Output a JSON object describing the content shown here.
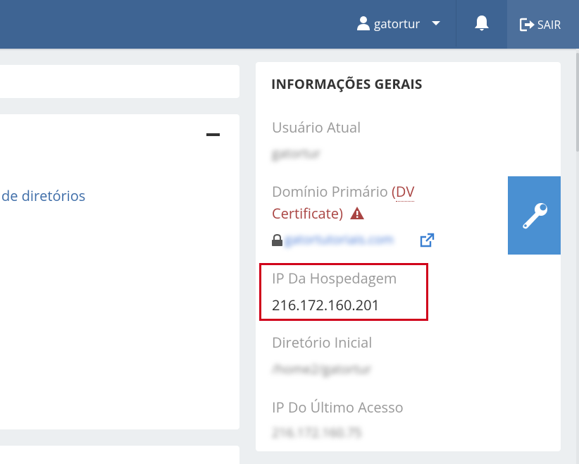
{
  "header": {
    "username": "gatortur",
    "logout_label": "SAIR",
    "icons": {
      "user": "user-icon",
      "caret": "caret-down-icon",
      "bell": "bell-icon",
      "logout": "sign-out-icon"
    },
    "colors": {
      "bar": "#3e6493",
      "logout_bg": "#4c6f9b"
    }
  },
  "main": {
    "directory_link": "de diretórios"
  },
  "general_info": {
    "title": "INFORMAÇÕES GERAIS",
    "current_user": {
      "label": "Usuário Atual",
      "value": "gatortur"
    },
    "primary_domain": {
      "label": "Domínio Primário",
      "cert_open": "(",
      "cert_link": "DV",
      "cert_rest": "Certificate)",
      "value": "gatortutoriais.com"
    },
    "hosting_ip": {
      "label": "IP Da Hospedagem",
      "value": "216.172.160.201"
    },
    "home_dir": {
      "label": "Diretório Inicial",
      "value": "/home2/gatortur"
    },
    "last_access_ip": {
      "label": "IP Do Último Acesso",
      "value": "216.172.160.75"
    }
  },
  "colors": {
    "highlight": "#d0021b",
    "wrench_button": "#4a90d2",
    "warning": "#a94442"
  }
}
